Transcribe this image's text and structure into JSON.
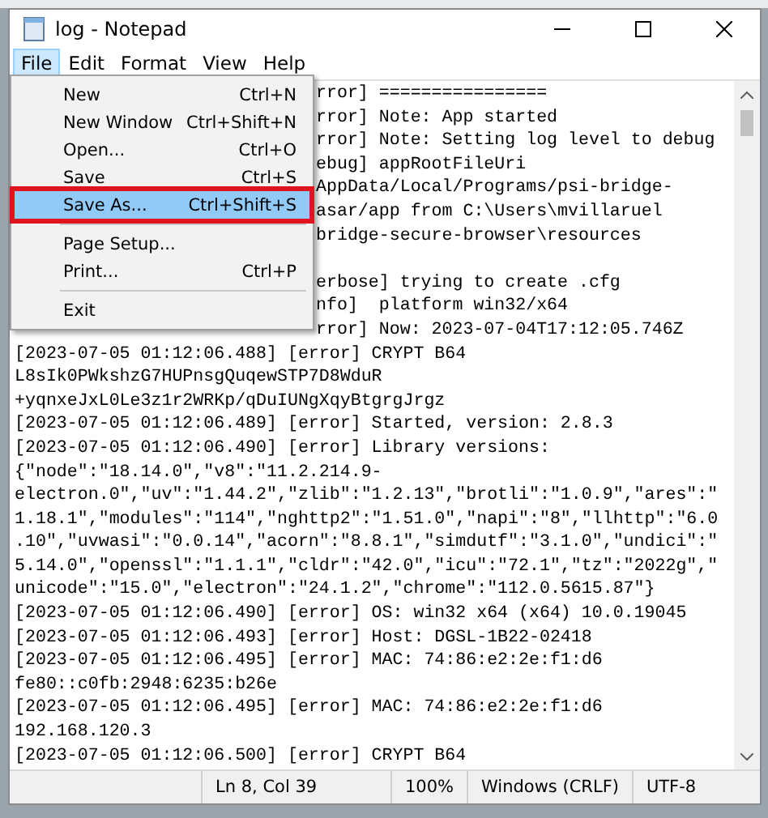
{
  "window": {
    "title": "log - Notepad"
  },
  "menu_bar": [
    {
      "label": "File",
      "selected": true
    },
    {
      "label": "Edit",
      "selected": false
    },
    {
      "label": "Format",
      "selected": false
    },
    {
      "label": "View",
      "selected": false
    },
    {
      "label": "Help",
      "selected": false
    }
  ],
  "file_menu": [
    {
      "kind": "item",
      "label": "New",
      "shortcut": "Ctrl+N",
      "selected": false,
      "outlined": false
    },
    {
      "kind": "item",
      "label": "New Window",
      "shortcut": "Ctrl+Shift+N",
      "selected": false,
      "outlined": false
    },
    {
      "kind": "item",
      "label": "Open...",
      "shortcut": "Ctrl+O",
      "selected": false,
      "outlined": false
    },
    {
      "kind": "item",
      "label": "Save",
      "shortcut": "Ctrl+S",
      "selected": false,
      "outlined": false
    },
    {
      "kind": "item",
      "label": "Save As...",
      "shortcut": "Ctrl+Shift+S",
      "selected": true,
      "outlined": true
    },
    {
      "kind": "separator"
    },
    {
      "kind": "item",
      "label": "Page Setup...",
      "selected": false,
      "outlined": false
    },
    {
      "kind": "item",
      "label": "Print...",
      "shortcut": "Ctrl+P",
      "selected": false,
      "outlined": false
    },
    {
      "kind": "separator"
    },
    {
      "kind": "item",
      "label": "Exit",
      "selected": false,
      "outlined": false
    }
  ],
  "editor_lines": [
    {
      "kind": "partial",
      "text": "rror] ================"
    },
    {
      "kind": "partial",
      "text": "rror] Note: App started"
    },
    {
      "kind": "partial",
      "text": "rror] Note: Setting log level to debug"
    },
    {
      "kind": "partial",
      "text": "ebug] appRootFileUri"
    },
    {
      "kind": "partial",
      "text": "AppData/Local/Programs/psi-bridge-"
    },
    {
      "kind": "partial",
      "text": "asar/app from C:\\Users\\mvillaruel"
    },
    {
      "kind": "partial",
      "text": "bridge-secure-browser\\resources"
    },
    {
      "kind": "blank"
    },
    {
      "kind": "partial",
      "text": "erbose] trying to create .cfg"
    },
    {
      "kind": "partial",
      "text": "nfo]  platform win32/x64"
    },
    {
      "kind": "partial",
      "text": "rror] Now: 2023-07-04T17:12:05.746Z"
    },
    {
      "kind": "full",
      "text": "[2023-07-05 01:12:06.488] [error] CRYPT B64"
    },
    {
      "kind": "full",
      "text": "L8sIk0PWkshzG7HUPnsgQuqewSTP7D8WduR"
    },
    {
      "kind": "full",
      "text": "+yqnxeJxL0Le3z1r2WRKp/qDuIUNgXqyBtgrgJrgz"
    },
    {
      "kind": "full",
      "text": "[2023-07-05 01:12:06.489] [error] Started, version: 2.8.3"
    },
    {
      "kind": "full",
      "text": "[2023-07-05 01:12:06.490] [error] Library versions:"
    },
    {
      "kind": "full",
      "text": "{\"node\":\"18.14.0\",\"v8\":\"11.2.214.9-"
    },
    {
      "kind": "full",
      "text": "electron.0\",\"uv\":\"1.44.2\",\"zlib\":\"1.2.13\",\"brotli\":\"1.0.9\",\"ares\":\""
    },
    {
      "kind": "full",
      "text": "1.18.1\",\"modules\":\"114\",\"nghttp2\":\"1.51.0\",\"napi\":\"8\",\"llhttp\":\"6.0"
    },
    {
      "kind": "full",
      "text": ".10\",\"uvwasi\":\"0.0.14\",\"acorn\":\"8.8.1\",\"simdutf\":\"3.1.0\",\"undici\":\""
    },
    {
      "kind": "full",
      "text": "5.14.0\",\"openssl\":\"1.1.1\",\"cldr\":\"42.0\",\"icu\":\"72.1\",\"tz\":\"2022g\",\""
    },
    {
      "kind": "full",
      "text": "unicode\":\"15.0\",\"electron\":\"24.1.2\",\"chrome\":\"112.0.5615.87\"}"
    },
    {
      "kind": "full",
      "text": "[2023-07-05 01:12:06.490] [error] OS: win32 x64 (x64) 10.0.19045"
    },
    {
      "kind": "full",
      "text": "[2023-07-05 01:12:06.493] [error] Host: DGSL-1B22-02418"
    },
    {
      "kind": "full",
      "text": "[2023-07-05 01:12:06.495] [error] MAC: 74:86:e2:2e:f1:d6"
    },
    {
      "kind": "full",
      "text": "fe80::c0fb:2948:6235:b26e"
    },
    {
      "kind": "full",
      "text": "[2023-07-05 01:12:06.495] [error] MAC: 74:86:e2:2e:f1:d6"
    },
    {
      "kind": "full",
      "text": "192.168.120.3"
    },
    {
      "kind": "full",
      "text": "[2023-07-05 01:12:06.500] [error] CRYPT B64"
    }
  ],
  "status_bar": [
    "Ln 8, Col 39",
    "100%",
    "Windows (CRLF)",
    "UTF-8"
  ]
}
